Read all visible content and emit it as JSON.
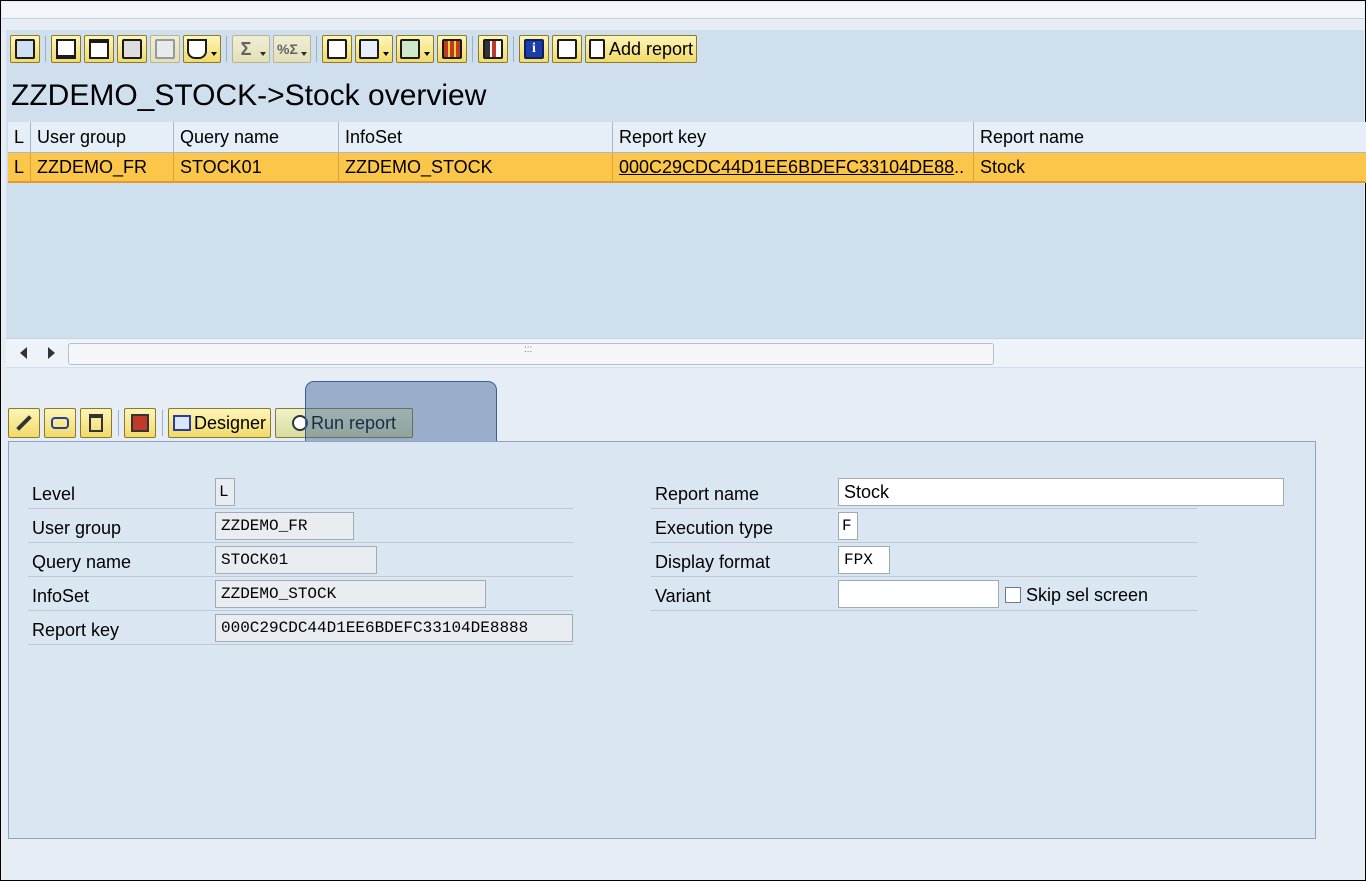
{
  "toolbar": {
    "buttons": [
      {
        "icon": "details-icon"
      },
      {
        "icon": "sort-ascending-icon"
      },
      {
        "icon": "sort-descending-icon"
      },
      {
        "icon": "find-icon"
      },
      {
        "icon": "find-next-icon"
      },
      {
        "icon": "filter-icon"
      },
      {
        "icon": "sum-icon"
      },
      {
        "icon": "subtotal-icon"
      },
      {
        "icon": "print-preview-icon"
      },
      {
        "icon": "views-icon"
      },
      {
        "icon": "export-icon"
      },
      {
        "icon": "layout-icon"
      },
      {
        "icon": "graphic-icon"
      },
      {
        "icon": "information-icon"
      },
      {
        "icon": "edit-icon"
      }
    ],
    "add_report_label": "Add report",
    "info_glyph": "i",
    "sum_glyph": "Σ",
    "subtotal_glyph": "%Σ"
  },
  "page_title": "ZZDEMO_STOCK->Stock overview",
  "table": {
    "columns": [
      "L",
      "User group",
      "Query name",
      "InfoSet",
      "Report key",
      "Report name"
    ],
    "rows": [
      {
        "l": "L",
        "user_group": "ZZDEMO_FR",
        "query_name": "STOCK01",
        "infoset": "ZZDEMO_STOCK",
        "report_key": "000C29CDC44D1EE6BDEFC33104DE88",
        "report_name": "Stock"
      }
    ]
  },
  "lower_toolbar": {
    "designer_label": "Designer",
    "run_report_label": "Run report"
  },
  "form": {
    "left": [
      {
        "label": "Level",
        "value": "L"
      },
      {
        "label": "User group",
        "value": "ZZDEMO_FR"
      },
      {
        "label": "Query name",
        "value": "STOCK01"
      },
      {
        "label": "InfoSet",
        "value": "ZZDEMO_STOCK"
      },
      {
        "label": "Report key",
        "value": "000C29CDC44D1EE6BDEFC33104DE8888"
      }
    ],
    "right": [
      {
        "label": "Report name",
        "value": "Stock"
      },
      {
        "label": "Execution type",
        "value": "F"
      },
      {
        "label": "Display format",
        "value": "FPX"
      },
      {
        "label": "Variant",
        "value": ""
      }
    ],
    "skip_sel_screen_label": "Skip sel screen",
    "skip_sel_screen_checked": false
  },
  "colors": {
    "selected_row": "#fbc64a",
    "toolbar_button": "#f1da6a",
    "panel_bg": "#dae6f1",
    "highlight_overlay": "#3c5f96"
  }
}
